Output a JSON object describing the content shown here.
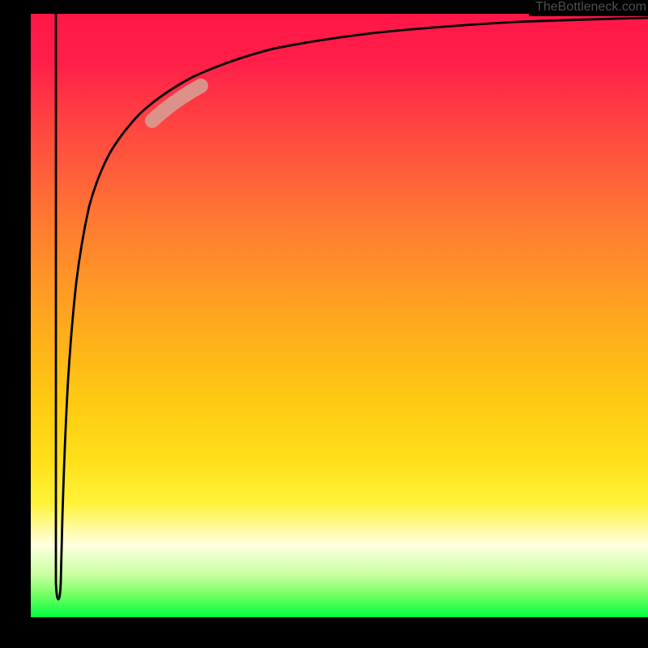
{
  "attribution": "TheBottleneck.com",
  "colors": {
    "page_bg": "#000000",
    "gradient_top": "#ff1648",
    "gradient_mid": "#ffdc1a",
    "gradient_bottom": "#00ff3c",
    "curve": "#000000",
    "highlight": "#d89a8e",
    "attribution_text": "#4f4f4f"
  },
  "chart_data": {
    "type": "line",
    "title": "",
    "xlabel": "",
    "ylabel": "",
    "grid": false,
    "legend": false,
    "xlim": [
      0,
      100
    ],
    "ylim": [
      0,
      100
    ],
    "x": [
      0.0,
      0.2,
      0.4,
      0.6,
      0.8,
      1.0,
      1.2,
      1.4,
      1.6,
      2.0,
      2.5,
      3.2,
      4.5,
      6.0,
      8.0,
      11.0,
      15.0,
      21.0,
      28.0,
      38.0,
      50.0,
      65.0,
      80.0,
      100.0
    ],
    "values": [
      98.0,
      10.0,
      2.0,
      2.0,
      10.0,
      20.0,
      35.0,
      46.0,
      54.0,
      64.0,
      71.0,
      76.0,
      82.0,
      86.0,
      88.5,
      90.3,
      92.0,
      93.5,
      94.7,
      95.7,
      96.4,
      96.8,
      97.0,
      97.1
    ],
    "annotations": [
      {
        "name": "highlight",
        "x_range": [
          15.0,
          23.0
        ],
        "y_range": [
          78.5,
          86.5
        ]
      }
    ],
    "notes": "Background is a vertical red→yellow→green gradient; axes and numeric tick labels are not rendered in the image; values are estimated from the plotted curve relative to the plot area."
  }
}
